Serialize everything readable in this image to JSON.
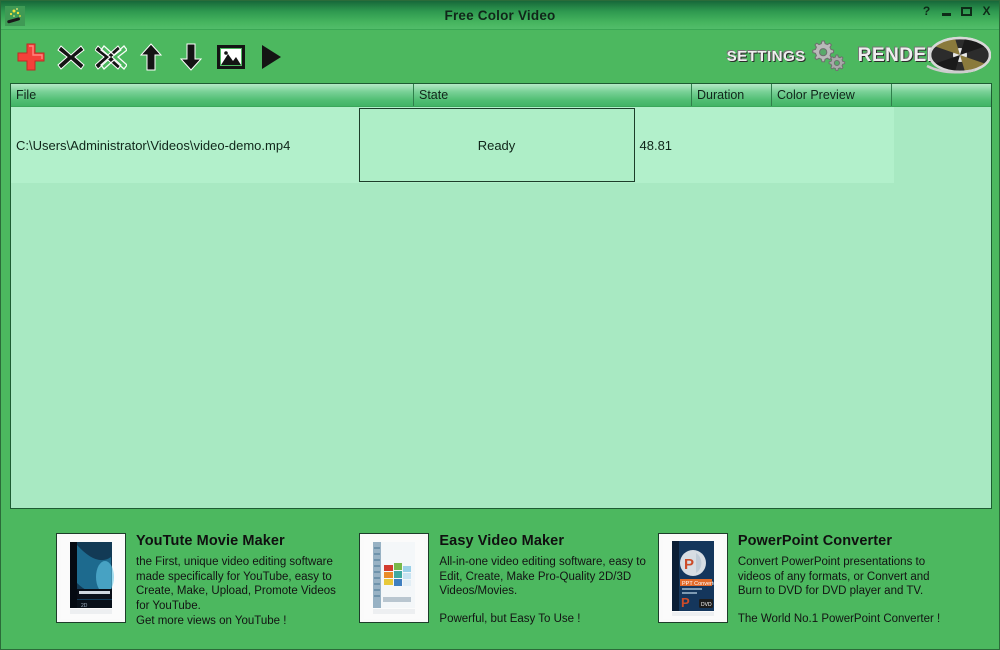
{
  "window": {
    "title": "Free Color Video",
    "app_icon": "magic-wand-icon",
    "controls": {
      "help": "?",
      "minimize": "minimize-icon",
      "maximize": "maximize-icon",
      "close": "X"
    }
  },
  "colors": {
    "background": "#4cb85f",
    "titlebar_dark": "#17683a",
    "titlebar_light": "#52bd6a",
    "list_background": "#a8e9c2",
    "row_selected": "#b2f0cb",
    "header_gradient_top": "#b5e9c6",
    "header_gradient_bottom": "#42b466",
    "add_icon_red": "#f4403a",
    "border_dark": "#1d5c32"
  },
  "toolbar": {
    "buttons": [
      {
        "name": "add-file-button",
        "icon": "plus-icon",
        "label": "Add"
      },
      {
        "name": "remove-file-button",
        "icon": "x-icon",
        "label": "Remove"
      },
      {
        "name": "remove-all-button",
        "icon": "double-x-icon",
        "label": "Remove All"
      },
      {
        "name": "move-up-button",
        "icon": "arrow-up-icon",
        "label": "Move Up"
      },
      {
        "name": "move-down-button",
        "icon": "arrow-down-icon",
        "label": "Move Down"
      },
      {
        "name": "preview-image-button",
        "icon": "image-icon",
        "label": "Preview"
      },
      {
        "name": "play-button",
        "icon": "play-icon",
        "label": "Play"
      }
    ],
    "settings_label": "SETTINGS",
    "render_label": "RENDER"
  },
  "list": {
    "columns": [
      {
        "key": "file",
        "label": "File"
      },
      {
        "key": "state",
        "label": "State"
      },
      {
        "key": "duration",
        "label": "Duration"
      },
      {
        "key": "preview",
        "label": "Color Preview"
      },
      {
        "key": "extra",
        "label": ""
      }
    ],
    "rows": [
      {
        "file": "C:\\Users\\Administrator\\Videos\\video-demo.mp4",
        "state": "Ready",
        "duration": "48.81",
        "preview": "",
        "extra": ""
      }
    ]
  },
  "ads": [
    {
      "thumb": "youtube-movie-maker-boxshot",
      "title": "YouTute Movie Maker",
      "body": "the First, unique video editing software\nmade specifically for YouTube, easy to\nCreate, Make, Upload, Promote Videos\nfor YouTube.",
      "tagline": "Get more views on YouTube !",
      "tagline_spaced": false
    },
    {
      "thumb": "easy-video-maker-boxshot",
      "title": "Easy Video Maker",
      "body": "All-in-one video editing software, easy to\nEdit, Create, Make Pro-Quality 2D/3D\nVideos/Movies.",
      "tagline": "Powerful, but Easy To Use !",
      "tagline_spaced": true
    },
    {
      "thumb": "powerpoint-converter-boxshot",
      "title": "PowerPoint Converter",
      "body": "Convert PowerPoint presentations to\nvideos of any formats, or Convert and\nBurn to DVD for DVD player and TV.",
      "tagline": "The World No.1 PowerPoint Converter !",
      "tagline_spaced": true
    }
  ]
}
